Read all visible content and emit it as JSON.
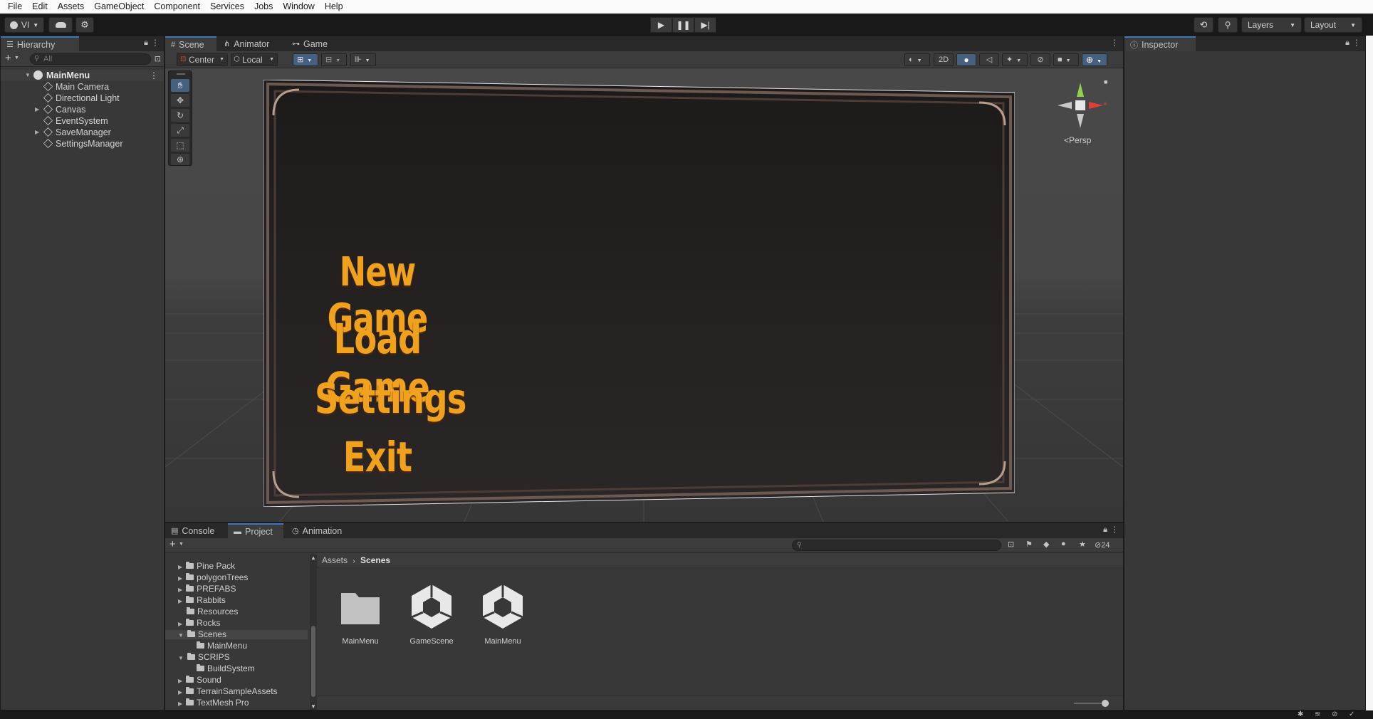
{
  "menubar": [
    "File",
    "Edit",
    "Assets",
    "GameObject",
    "Component",
    "Services",
    "Jobs",
    "Window",
    "Help"
  ],
  "toolbar": {
    "account_label": "VI",
    "layers_label": "Layers",
    "layout_label": "Layout"
  },
  "hierarchy": {
    "tab": "Hierarchy",
    "search_placeholder": "All",
    "scene": "MainMenu",
    "items": [
      "Main Camera",
      "Directional Light",
      "Canvas",
      "EventSystem",
      "SaveManager",
      "SettingsManager"
    ]
  },
  "scene_view": {
    "tabs": [
      "Scene",
      "Animator",
      "Game"
    ],
    "pivot": "Center",
    "space": "Local",
    "mode_2d": "2D",
    "persp_label": "Persp",
    "menu_items": [
      "New Game",
      "Load Game",
      "Settings",
      "Exit"
    ]
  },
  "inspector": {
    "tab": "Inspector"
  },
  "bottom": {
    "tabs": [
      "Console",
      "Project",
      "Animation"
    ],
    "folders": [
      "Pine Pack",
      "polygonTrees",
      "PREFABS",
      "Rabbits",
      "Resources",
      "Rocks",
      "Scenes",
      "MainMenu",
      "SCRIPS",
      "BuildSystem",
      "Sound",
      "TerrainSampleAssets",
      "TextMesh Pro"
    ],
    "breadcrumb": [
      "Assets",
      "Scenes"
    ],
    "assets": [
      "MainMenu",
      "GameScene",
      "MainMenu"
    ],
    "hidden_count": "24"
  },
  "colors": {
    "accent": "#3a79bb",
    "menu_text": "#f0a21e",
    "panel_bg": "#383838"
  }
}
